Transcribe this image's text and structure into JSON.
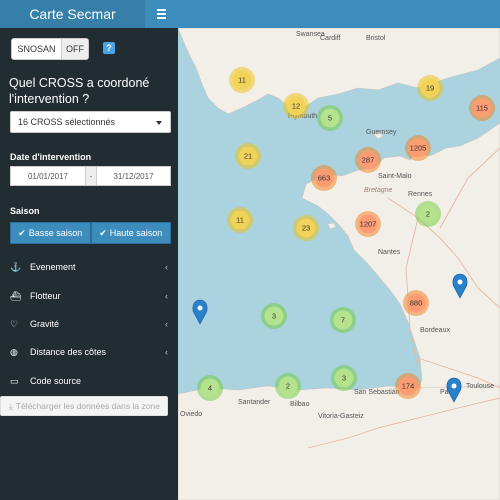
{
  "app": {
    "title": "Carte Secmar"
  },
  "sidebar": {
    "switch": {
      "on_label": "SNOSAN",
      "off_label": "OFF"
    },
    "help_label": "?",
    "question": "Quel CROSS a coordoné l'intervention ?",
    "cross_select": {
      "value": "16 CROSS sélectionnés"
    },
    "date_label": "Date d'intervention",
    "date_from": "01/01/2017",
    "date_sep": "-",
    "date_to": "31/12/2017",
    "season_label": "Saison",
    "season_low": "Basse saison",
    "season_high": "Haute saison",
    "nav": [
      {
        "label": "Evenement",
        "icon": "anchor-icon"
      },
      {
        "label": "Flotteur",
        "icon": "ship-icon"
      },
      {
        "label": "Gravité",
        "icon": "heartbeat-icon"
      },
      {
        "label": "Distance des côtes",
        "icon": "globe-icon"
      },
      {
        "label": "Code source",
        "icon": "file-icon"
      }
    ],
    "download": "Télécharger les données dans la zone"
  },
  "map": {
    "place_labels": [
      "Swansea",
      "Cardiff",
      "Bristol",
      "Plymouth",
      "Guernsey",
      "Saint-Malo",
      "Rennes",
      "Bretagne",
      "Nantes",
      "Bordeaux",
      "Toulouse",
      "Vitoria-Gasteiz",
      "Bilbao",
      "San Sebastián",
      "Pau",
      "Santander",
      "Oviedo"
    ],
    "clusters": [
      {
        "count": "11",
        "tone": "yellow"
      },
      {
        "count": "12",
        "tone": "yellow"
      },
      {
        "count": "5",
        "tone": "green"
      },
      {
        "count": "19",
        "tone": "yellow"
      },
      {
        "count": "115",
        "tone": "orange"
      },
      {
        "count": "21",
        "tone": "yellow"
      },
      {
        "count": "287",
        "tone": "orange"
      },
      {
        "count": "1205",
        "tone": "orange"
      },
      {
        "count": "663",
        "tone": "orange"
      },
      {
        "count": "2",
        "tone": "green"
      },
      {
        "count": "11",
        "tone": "yellow"
      },
      {
        "count": "23",
        "tone": "yellow"
      },
      {
        "count": "1207",
        "tone": "orange"
      },
      {
        "count": "880",
        "tone": "orange"
      },
      {
        "count": "3",
        "tone": "green"
      },
      {
        "count": "7",
        "tone": "green"
      },
      {
        "count": "4",
        "tone": "green"
      },
      {
        "count": "2",
        "tone": "green"
      },
      {
        "count": "3",
        "tone": "green"
      },
      {
        "count": "174",
        "tone": "orange"
      }
    ],
    "colors": {
      "yellow": "#f1d357",
      "green": "#b5e28c",
      "orange": "#fd9c73",
      "marker": "#2a81cb",
      "sea": "#aad3df",
      "land": "#f2efe9"
    }
  }
}
